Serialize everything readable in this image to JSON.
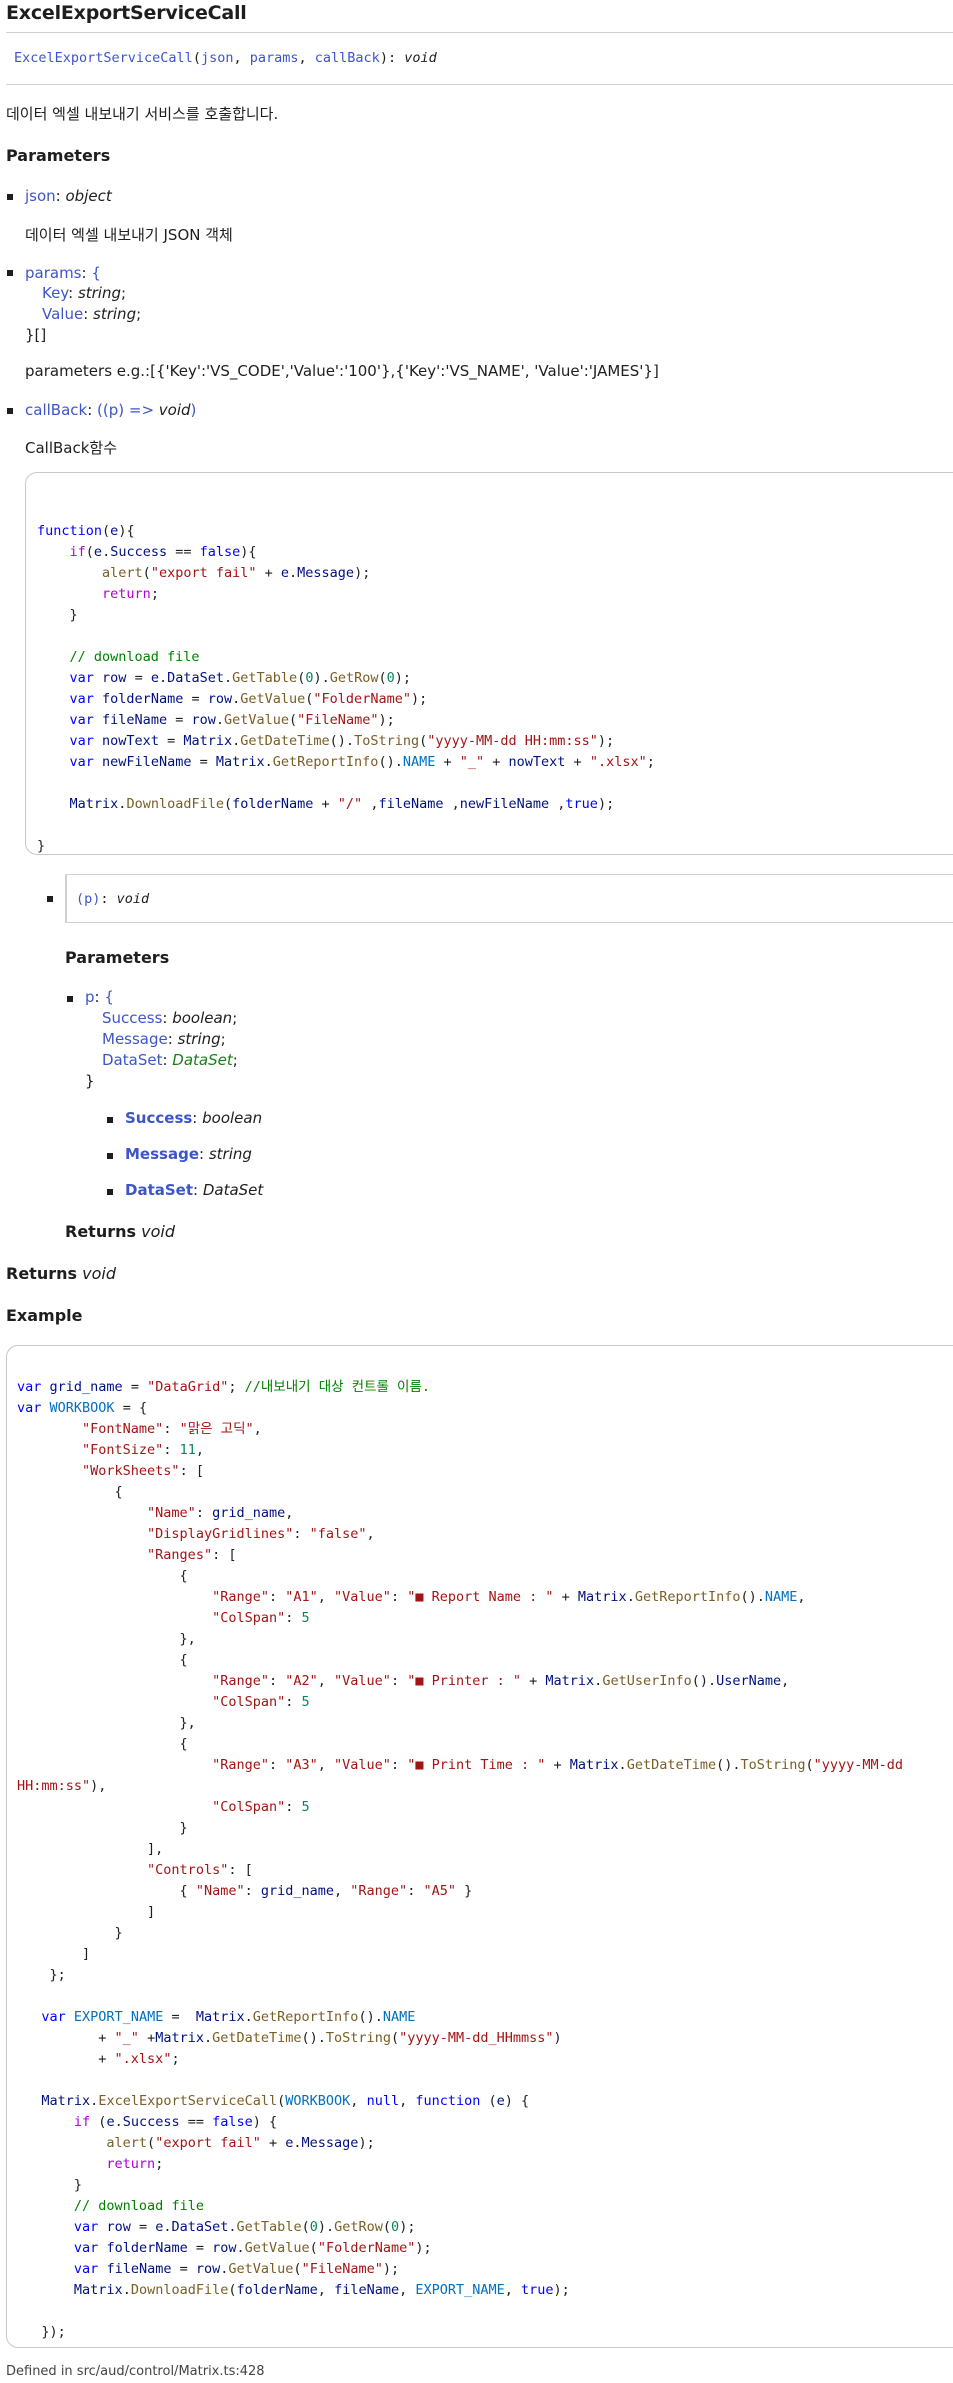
{
  "title": "ExcelExportServiceCall",
  "signature": {
    "name": "ExcelExportServiceCall",
    "params": [
      "json",
      "params",
      "callBack"
    ],
    "returns": "void"
  },
  "description": "데이터 엑셀 내보내기 서비스를 호출합니다.",
  "parameters_heading": "Parameters",
  "params": [
    {
      "name": "json",
      "type": "object",
      "desc": "데이터 엑셀 내보내기 JSON 객체"
    },
    {
      "name": "params",
      "type_open": "{",
      "fields": [
        {
          "name": "Key",
          "type": "string"
        },
        {
          "name": "Value",
          "type": "string"
        }
      ],
      "type_close": "}[]",
      "desc": "parameters e.g.:[{'Key':'VS_CODE','Value':'100'},{'Key':'VS_NAME', 'Value':'JAMES'}]"
    },
    {
      "name": "callBack",
      "type_prefix": "((p) => ",
      "type": "void",
      "type_suffix": ")",
      "desc": "CallBack함수"
    }
  ],
  "callback_sig": {
    "param": "(p)",
    "sep": ": ",
    "returns": "void"
  },
  "callback_params_heading": "Parameters",
  "callback_param": {
    "name": "p",
    "type_open": "{",
    "fields": [
      {
        "name": "Success",
        "type": "boolean"
      },
      {
        "name": "Message",
        "type": "string"
      },
      {
        "name": "DataSet",
        "type": "DataSet"
      }
    ],
    "type_close": "}",
    "members": [
      {
        "name": "Success",
        "type": "boolean"
      },
      {
        "name": "Message",
        "type": "string"
      },
      {
        "name": "DataSet",
        "type": "DataSet"
      }
    ]
  },
  "callback_returns": {
    "label": "Returns",
    "type": "void"
  },
  "returns": {
    "label": "Returns",
    "type": "void"
  },
  "example_heading": "Example",
  "footer": "Defined in src/aud/control/Matrix.ts:428"
}
